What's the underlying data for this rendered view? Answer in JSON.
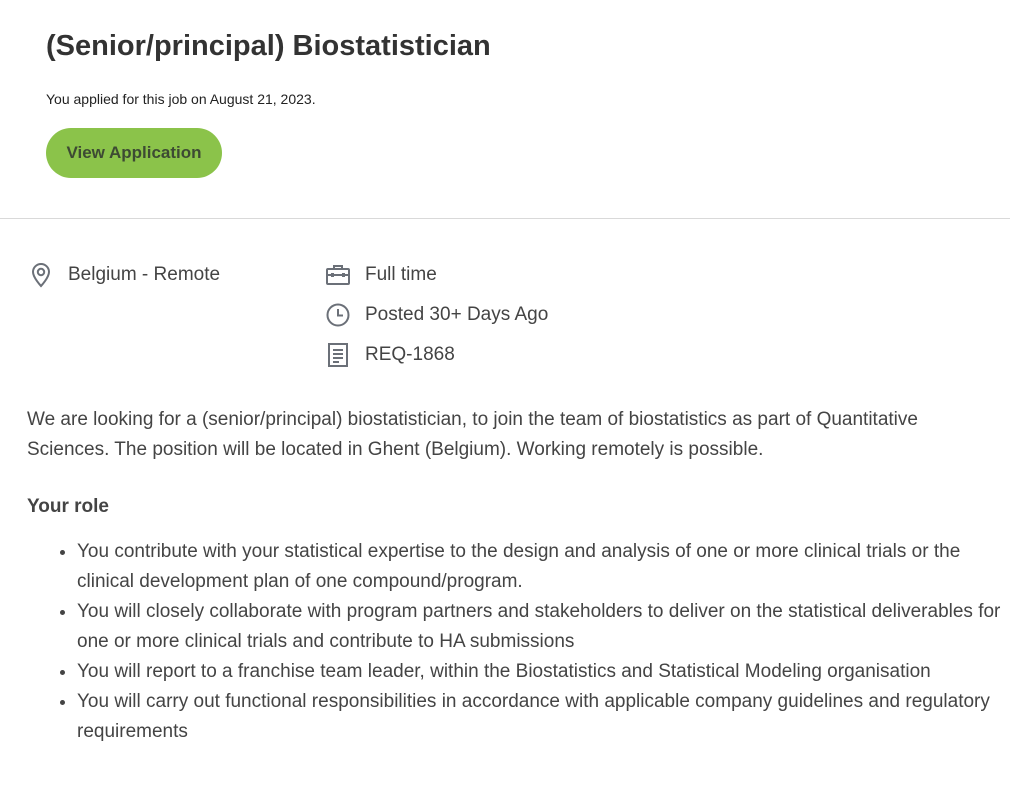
{
  "job": {
    "title": "(Senior/principal) Biostatistician",
    "applied_note": "You applied for this job on August 21, 2023.",
    "view_button_label": "View Application"
  },
  "meta": {
    "location": "Belgium - Remote",
    "employment_type": "Full time",
    "posted": "Posted 30+ Days Ago",
    "requisition": "REQ-1868"
  },
  "icons": {
    "location": "location-pin-icon",
    "employment_type": "briefcase-icon",
    "posted": "clock-icon",
    "requisition": "document-icon"
  },
  "colors": {
    "accent_button": "#8bc34a",
    "icon_gray": "#6b7078"
  },
  "description": {
    "intro": "We are looking for a (senior/principal) biostatistician, to join the team of biostatistics as part of Quantitative Sciences. The position will be located in Ghent (Belgium). Working remotely is possible.",
    "role_heading": "Your role",
    "role_items": [
      "You contribute with your statistical expertise to the design and analysis of one or more clinical trials or the clinical development plan of one compound/program.",
      "You will closely collaborate with program partners and stakeholders to deliver on the statistical deliverables for one or more clinical trials and contribute to HA submissions",
      "You will report to a franchise team leader, within the Biostatistics and Statistical Modeling organisation",
      "You will carry out functional responsibilities in accordance with applicable company guidelines and regulatory requirements"
    ]
  }
}
